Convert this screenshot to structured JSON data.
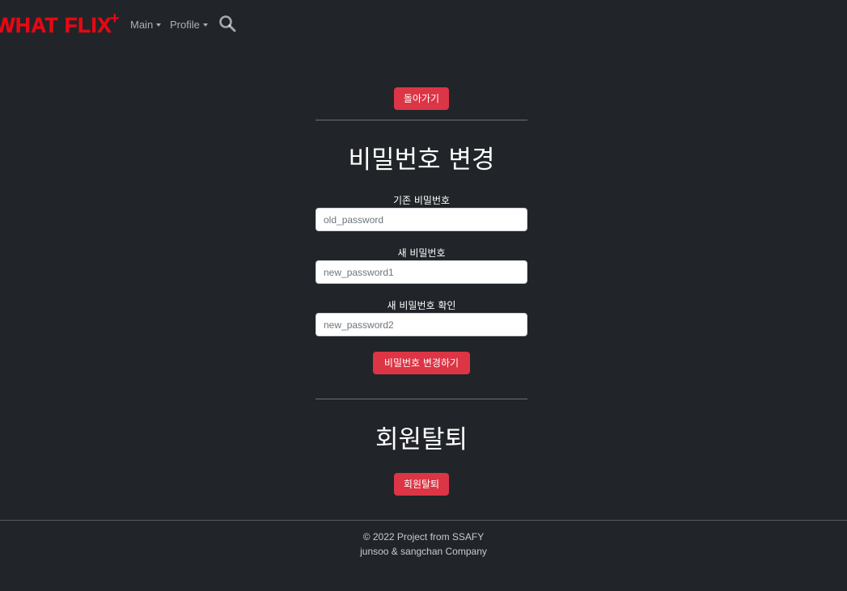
{
  "brand": {
    "name": "WHAT FLIX",
    "plus": "+",
    "color": "#e50914"
  },
  "nav": {
    "items": [
      {
        "label": "Main"
      },
      {
        "label": "Profile"
      }
    ],
    "search_icon": "search-icon"
  },
  "main": {
    "back_button": "돌아가기",
    "password_section": {
      "title": "비밀번호 변경",
      "fields": [
        {
          "label": "기존 비밀번호",
          "placeholder": "old_password",
          "value": ""
        },
        {
          "label": "새 비밀번호",
          "placeholder": "new_password1",
          "value": ""
        },
        {
          "label": "새 비밀번호 확인",
          "placeholder": "new_password2",
          "value": ""
        }
      ],
      "submit_button": "비밀번호 변경하기"
    },
    "withdraw_section": {
      "title": "회원탈퇴",
      "button": "회원탈퇴"
    }
  },
  "footer": {
    "line1": "© 2022 Project from SSAFY",
    "line2": "junsoo & sangchan Company"
  },
  "colors": {
    "background": "#212529",
    "accent_red": "#dc3545",
    "brand_red": "#e50914"
  }
}
